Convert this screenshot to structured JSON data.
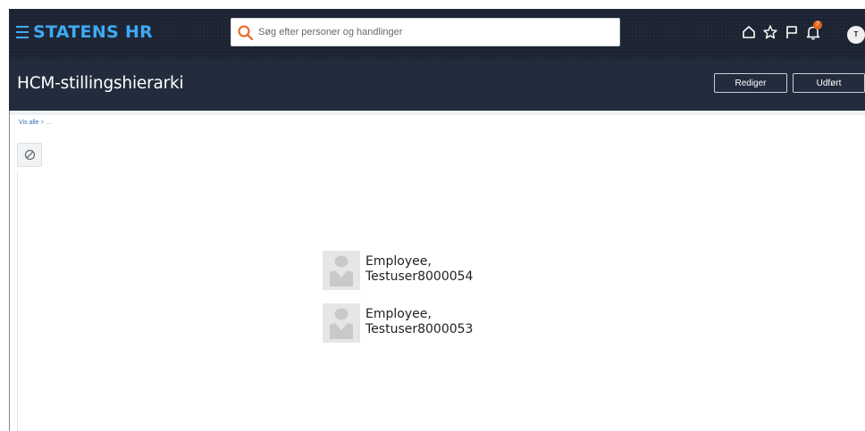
{
  "app": {
    "brand": "STATENS HR",
    "brand_color": "#3fa9f5"
  },
  "search": {
    "placeholder": "Søg efter personer og handlinger",
    "value": ""
  },
  "toolbar_icons": [
    "home-icon",
    "star-icon",
    "flag-icon",
    "bell-icon"
  ],
  "notifications": {
    "count": "7",
    "badge_color": "#e8641b"
  },
  "user": {
    "initials": "T"
  },
  "page": {
    "title": "HCM-stillingshierarki",
    "buttons": {
      "edit": "Rediger",
      "done": "Udført"
    }
  },
  "breadcrumb": {
    "link": "Vis alle",
    "separator": " > ",
    "more": "..."
  },
  "tool_button_icon": "no-entry-icon",
  "people": [
    {
      "last_name": "Employee,",
      "first_name": "Testuser8000054"
    },
    {
      "last_name": "Employee,",
      "first_name": "Testuser8000053"
    }
  ],
  "colors": {
    "topbar_bg": "#1c2433",
    "header_bg": "#232c3d",
    "link": "#2a6fba"
  }
}
